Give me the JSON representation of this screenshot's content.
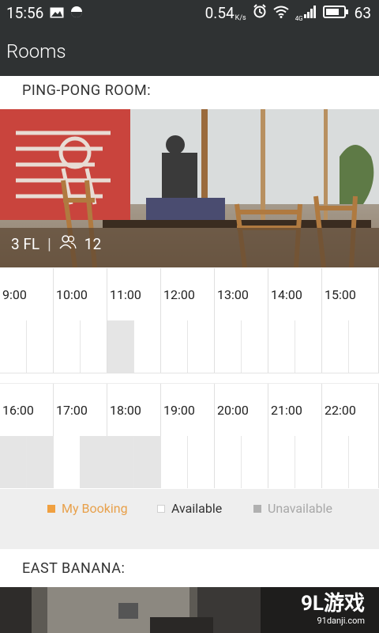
{
  "status_bar": {
    "time": "15:56",
    "speed": "0.54",
    "speed_unit": "K/s",
    "network": "4G",
    "battery": "63"
  },
  "app_bar": {
    "title": "Rooms"
  },
  "rooms": [
    {
      "name": "PING-PONG ROOM:",
      "floor": "3 FL",
      "capacity": "12",
      "rows": [
        {
          "slots": [
            {
              "time": "9:00",
              "halves": [
                "free",
                "free"
              ]
            },
            {
              "time": "10:00",
              "halves": [
                "free",
                "free"
              ]
            },
            {
              "time": "11:00",
              "halves": [
                "unavailable",
                "free"
              ]
            },
            {
              "time": "12:00",
              "halves": [
                "free",
                "free"
              ]
            },
            {
              "time": "13:00",
              "halves": [
                "free",
                "free"
              ]
            },
            {
              "time": "14:00",
              "halves": [
                "free",
                "free"
              ]
            },
            {
              "time": "15:00",
              "halves": [
                "free",
                "free"
              ]
            }
          ]
        },
        {
          "slots": [
            {
              "time": "16:00",
              "halves": [
                "unavailable",
                "unavailable"
              ]
            },
            {
              "time": "17:00",
              "halves": [
                "free",
                "unavailable"
              ]
            },
            {
              "time": "18:00",
              "halves": [
                "unavailable",
                "unavailable"
              ]
            },
            {
              "time": "19:00",
              "halves": [
                "free",
                "free"
              ]
            },
            {
              "time": "20:00",
              "halves": [
                "free",
                "free"
              ]
            },
            {
              "time": "21:00",
              "halves": [
                "free",
                "free"
              ]
            },
            {
              "time": "22:00",
              "halves": [
                "free",
                "free"
              ]
            }
          ]
        }
      ]
    },
    {
      "name": "EAST BANANA:"
    }
  ],
  "legend": {
    "my_booking": "My Booking",
    "available": "Available",
    "unavailable": "Unavailable"
  },
  "colors": {
    "bar": "#2f3233",
    "my_booking": "#f0a040",
    "unavailable": "#e5e5e5",
    "legend_bg": "#eeeeee"
  },
  "watermark": {
    "logo": "9L游戏",
    "url": "91danji.com"
  }
}
